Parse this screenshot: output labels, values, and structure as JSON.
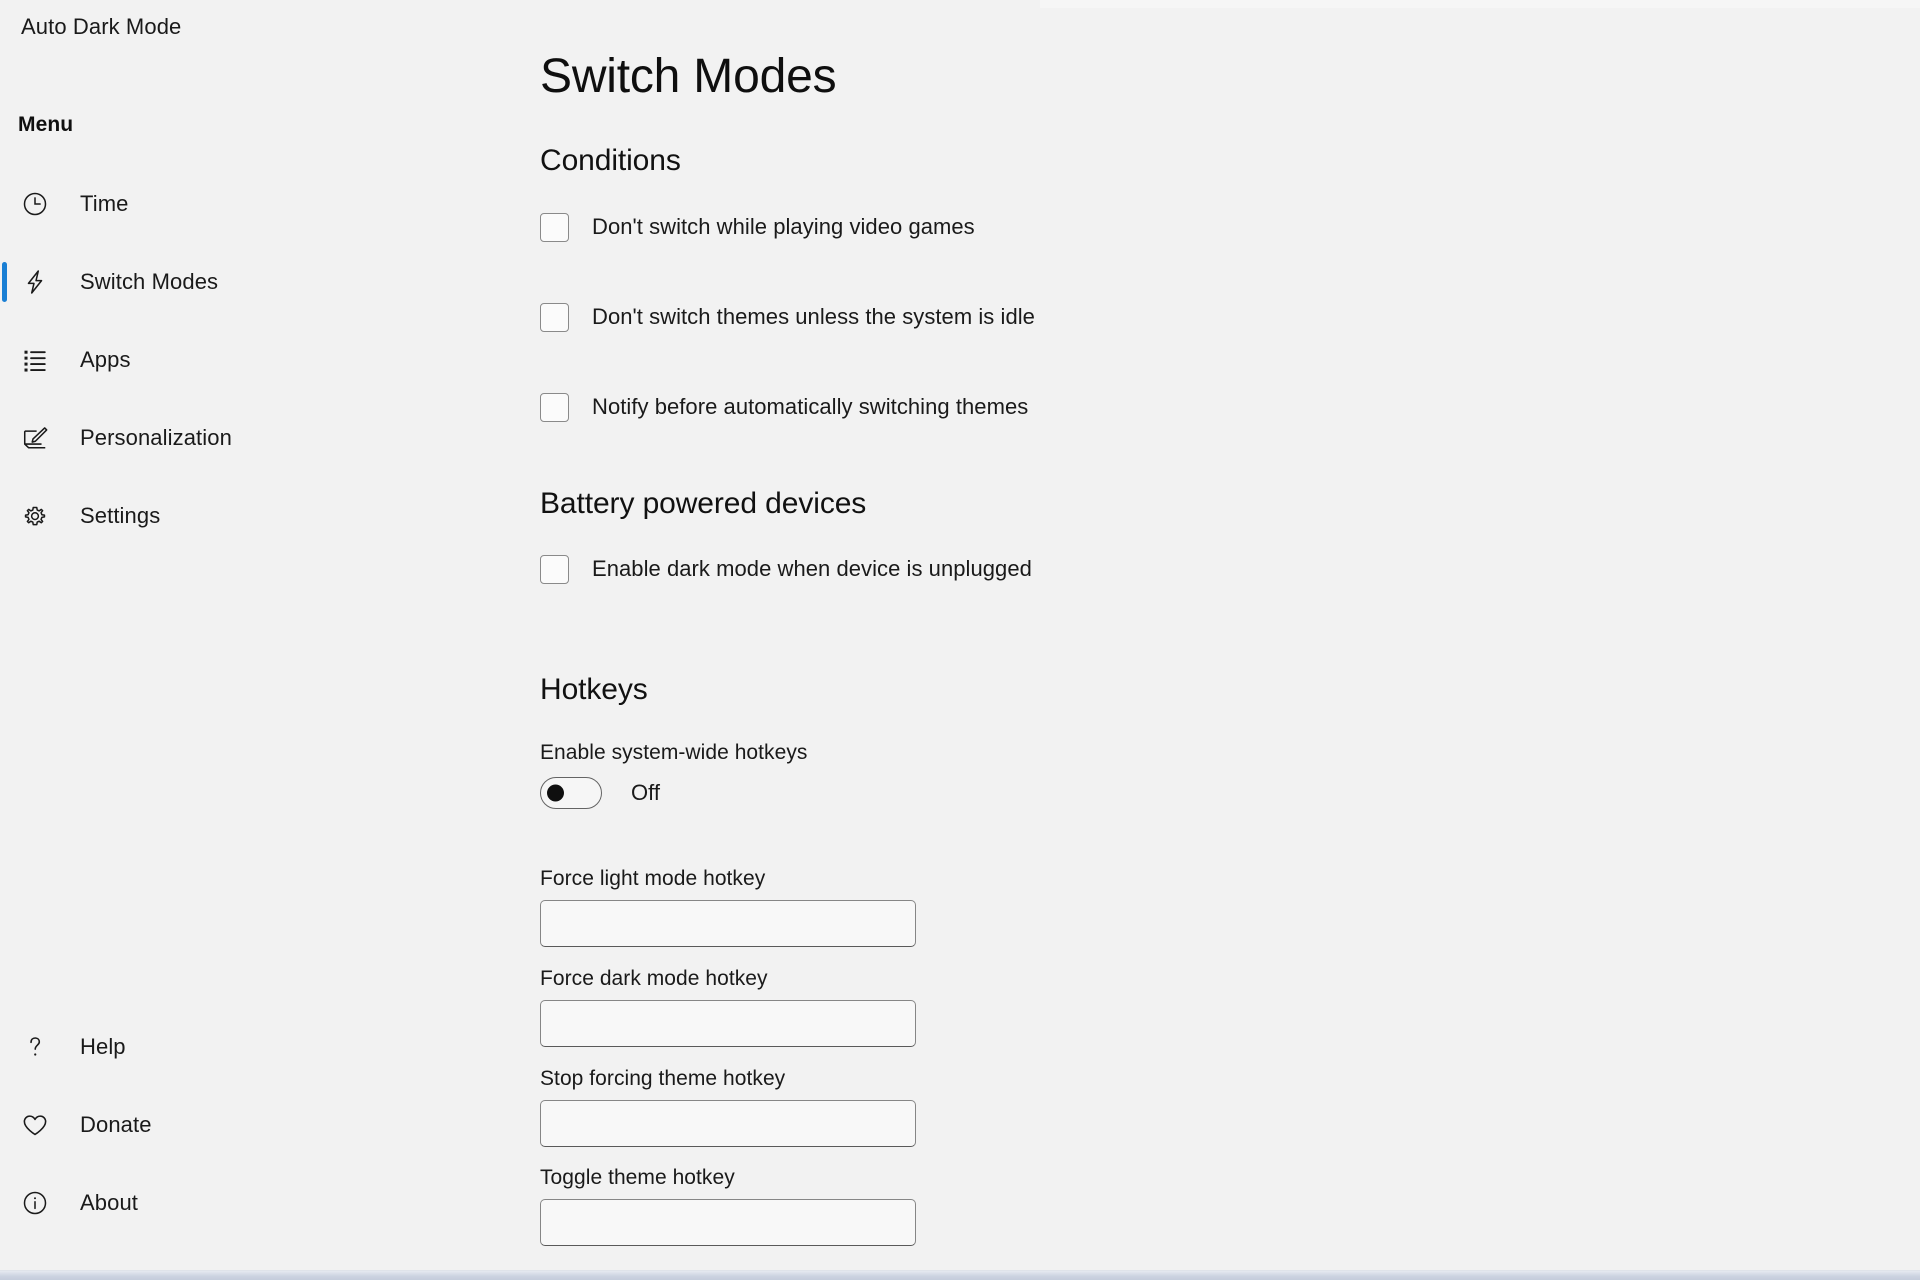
{
  "app": {
    "title": "Auto Dark Mode"
  },
  "sidebar": {
    "menu_heading": "Menu",
    "items": [
      {
        "label": "Time",
        "icon": "clock-icon",
        "selected": false
      },
      {
        "label": "Switch Modes",
        "icon": "lightning-bolt-icon",
        "selected": true
      },
      {
        "label": "Apps",
        "icon": "list-icon",
        "selected": false
      },
      {
        "label": "Personalization",
        "icon": "paintbrush-icon",
        "selected": false
      },
      {
        "label": "Settings",
        "icon": "gear-icon",
        "selected": false
      }
    ],
    "bottom_items": [
      {
        "label": "Help",
        "icon": "question-mark-icon"
      },
      {
        "label": "Donate",
        "icon": "heart-icon"
      },
      {
        "label": "About",
        "icon": "info-circle-icon"
      }
    ]
  },
  "main": {
    "page_title": "Switch Modes",
    "conditions": {
      "heading": "Conditions",
      "checkboxes": [
        {
          "label": "Don't switch while playing video games",
          "checked": false
        },
        {
          "label": "Don't switch themes unless the system is idle",
          "checked": false
        },
        {
          "label": "Notify before automatically switching themes",
          "checked": false
        }
      ]
    },
    "battery": {
      "heading": "Battery powered devices",
      "checkboxes": [
        {
          "label": "Enable dark mode when device is unplugged",
          "checked": false
        }
      ]
    },
    "hotkeys": {
      "heading": "Hotkeys",
      "enable_label": "Enable system-wide hotkeys",
      "enable_state": "Off",
      "enable_on": false,
      "fields": [
        {
          "label": "Force light mode hotkey",
          "value": "",
          "placeholder": ""
        },
        {
          "label": "Force dark mode hotkey",
          "value": "",
          "placeholder": ""
        },
        {
          "label": "Stop forcing theme hotkey",
          "value": "",
          "placeholder": ""
        },
        {
          "label": "Toggle theme hotkey",
          "value": "",
          "placeholder": ""
        }
      ]
    }
  },
  "colors": {
    "accent": "#1a7fd4",
    "background": "#f2f2f2",
    "text": "#1a1a1a",
    "border": "#8a8a8a",
    "statusbar": "#c4ccdc"
  }
}
